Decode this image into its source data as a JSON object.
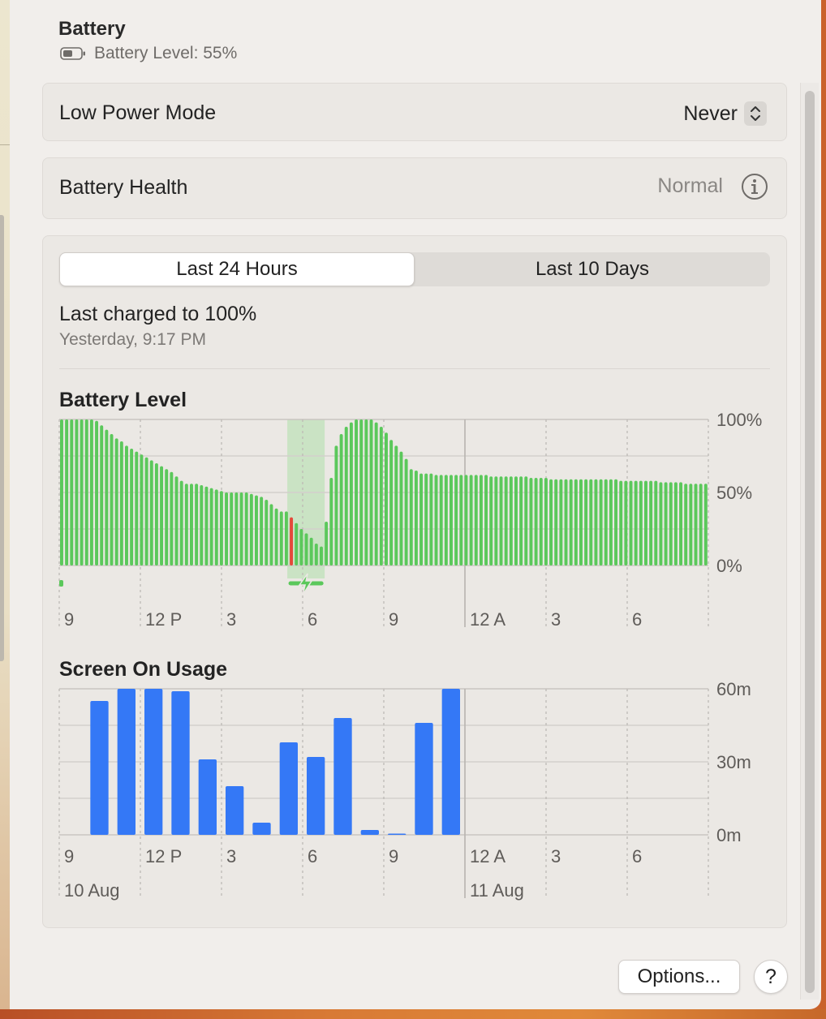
{
  "header": {
    "title": "Battery",
    "battery_level_text": "Battery Level: 55%"
  },
  "low_power": {
    "label": "Low Power Mode",
    "value": "Never"
  },
  "health": {
    "label": "Battery Health",
    "value": "Normal"
  },
  "usage": {
    "tabs": [
      {
        "label": "Last 24 Hours",
        "selected": true
      },
      {
        "label": "Last 10 Days",
        "selected": false
      }
    ],
    "last_charged_title": "Last charged to 100%",
    "last_charged_time": "Yesterday, 9:17 PM"
  },
  "footer": {
    "options_label": "Options...",
    "help_label": "?"
  },
  "colors": {
    "battery_green": "#5bc85b",
    "low_red": "#e5493a",
    "usage_blue": "#3478f6",
    "charging_band": "#bfe2b9"
  },
  "chart_data": [
    {
      "type": "bar",
      "title": "Battery Level",
      "x_tick_labels": [
        "9",
        "12 P",
        "3",
        "6",
        "9",
        "12 A",
        "3",
        "6"
      ],
      "y_tick_labels": [
        "100%",
        "50%",
        "0%"
      ],
      "ylim": [
        0,
        100
      ],
      "grid": true,
      "interval_minutes": 15,
      "start_time": "9:00 AM",
      "values": [
        100,
        100,
        100,
        100,
        100,
        100,
        100,
        99,
        96,
        93,
        90,
        87,
        85,
        82,
        80,
        78,
        76,
        74,
        72,
        70,
        68,
        66,
        64,
        61,
        58,
        56,
        56,
        56,
        55,
        54,
        53,
        52,
        51,
        50,
        50,
        50,
        50,
        50,
        49,
        48,
        47,
        45,
        42,
        39,
        37,
        37,
        33,
        29,
        25,
        22,
        19,
        15,
        13,
        30,
        60,
        82,
        90,
        95,
        98,
        100,
        100,
        100,
        100,
        98,
        95,
        91,
        86,
        82,
        78,
        73,
        66,
        65,
        63,
        63,
        63,
        62,
        62,
        62,
        62,
        62,
        62,
        62,
        62,
        62,
        62,
        62,
        61,
        61,
        61,
        61,
        61,
        61,
        61,
        61,
        60,
        60,
        60,
        60,
        59,
        59,
        59,
        59,
        59,
        59,
        59,
        59,
        59,
        59,
        59,
        59,
        59,
        59,
        58,
        58,
        58,
        58,
        58,
        58,
        58,
        58,
        57,
        57,
        57,
        57,
        57,
        56,
        56,
        56,
        56,
        56
      ],
      "low_index": 46,
      "charging_start_index": 46,
      "charging_end_index": 53
    },
    {
      "type": "bar",
      "title": "Screen On Usage",
      "x_tick_labels": [
        "9",
        "12 P",
        "3",
        "6",
        "9",
        "12 A",
        "3",
        "6"
      ],
      "date_labels": [
        "10 Aug",
        "11 Aug"
      ],
      "y_tick_labels": [
        "60m",
        "30m",
        "0m"
      ],
      "ylim": [
        0,
        60
      ],
      "ylabel": "",
      "interval_minutes": 60,
      "start_time": "9:00 AM",
      "values": [
        0,
        55,
        60,
        60,
        59,
        31,
        20,
        5,
        38,
        32,
        48,
        2,
        0.5,
        46,
        60,
        0,
        0,
        0,
        0,
        0,
        0,
        0,
        0,
        0
      ]
    }
  ]
}
